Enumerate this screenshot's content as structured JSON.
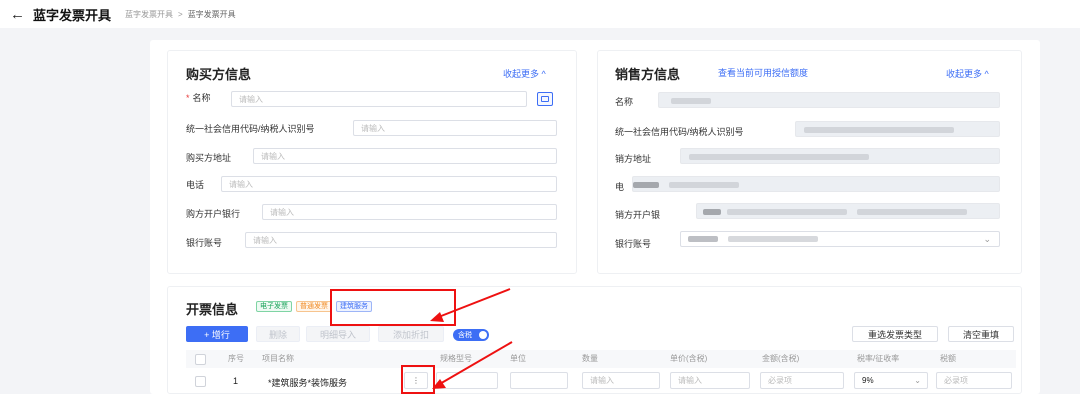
{
  "header": {
    "back_icon": "arrow-left-icon",
    "title": "蓝字发票开具",
    "breadcrumb": [
      "蓝字发票开具",
      "蓝字发票开具"
    ],
    "breadcrumb_sep": ">"
  },
  "buyer": {
    "title": "购买方信息",
    "collapse": "收起更多 ^",
    "fields": [
      {
        "label": "名称",
        "required": true,
        "placeholder": "请输入"
      },
      {
        "label": "统一社会信用代码/纳税人识别号",
        "required": false,
        "placeholder": "请输入"
      },
      {
        "label": "购买方地址",
        "required": false,
        "placeholder": "请输入"
      },
      {
        "label": "电话",
        "required": false,
        "placeholder": "请输入"
      },
      {
        "label": "购方开户银行",
        "required": false,
        "placeholder": "请输入"
      },
      {
        "label": "银行账号",
        "required": false,
        "placeholder": "请输入"
      }
    ]
  },
  "seller": {
    "title": "销售方信息",
    "quota_link": "查看当前可用授信额度",
    "collapse": "收起更多 ^",
    "fields": [
      {
        "label": "名称"
      },
      {
        "label": "统一社会信用代码/纳税人识别号"
      },
      {
        "label": "销方地址"
      },
      {
        "label": "电"
      },
      {
        "label": "销方开户银"
      },
      {
        "label": "银行账号"
      }
    ],
    "dropdown_icon": "chevron-down-icon"
  },
  "invoice": {
    "title": "开票信息",
    "tags": [
      "电子发票",
      "普通发票",
      "建筑服务"
    ],
    "buttons": {
      "add": "+ 增行",
      "delete": "删除",
      "batch_import": "明细导入",
      "add_discount": "添加折扣",
      "tax_toggle": "含税",
      "reselect_type": "重选发票类型",
      "clear": "清空重填"
    },
    "columns": [
      "序号",
      "项目名称",
      "规格型号",
      "单位",
      "数量",
      "单价(含税)",
      "金额(含税)",
      "税率/征收率",
      "税额"
    ],
    "rows": [
      {
        "index": "1",
        "item_name": "*建筑服务*装饰服务",
        "quantity_placeholder": "请输入",
        "price_placeholder": "请输入",
        "amount_placeholder": "必录项",
        "tax_rate": "9%",
        "tax_amount_placeholder": "必录项"
      }
    ],
    "more_icon": "more-vertical-icon"
  },
  "colors": {
    "accent": "#3d6ef5",
    "annotation": "#e11111"
  }
}
